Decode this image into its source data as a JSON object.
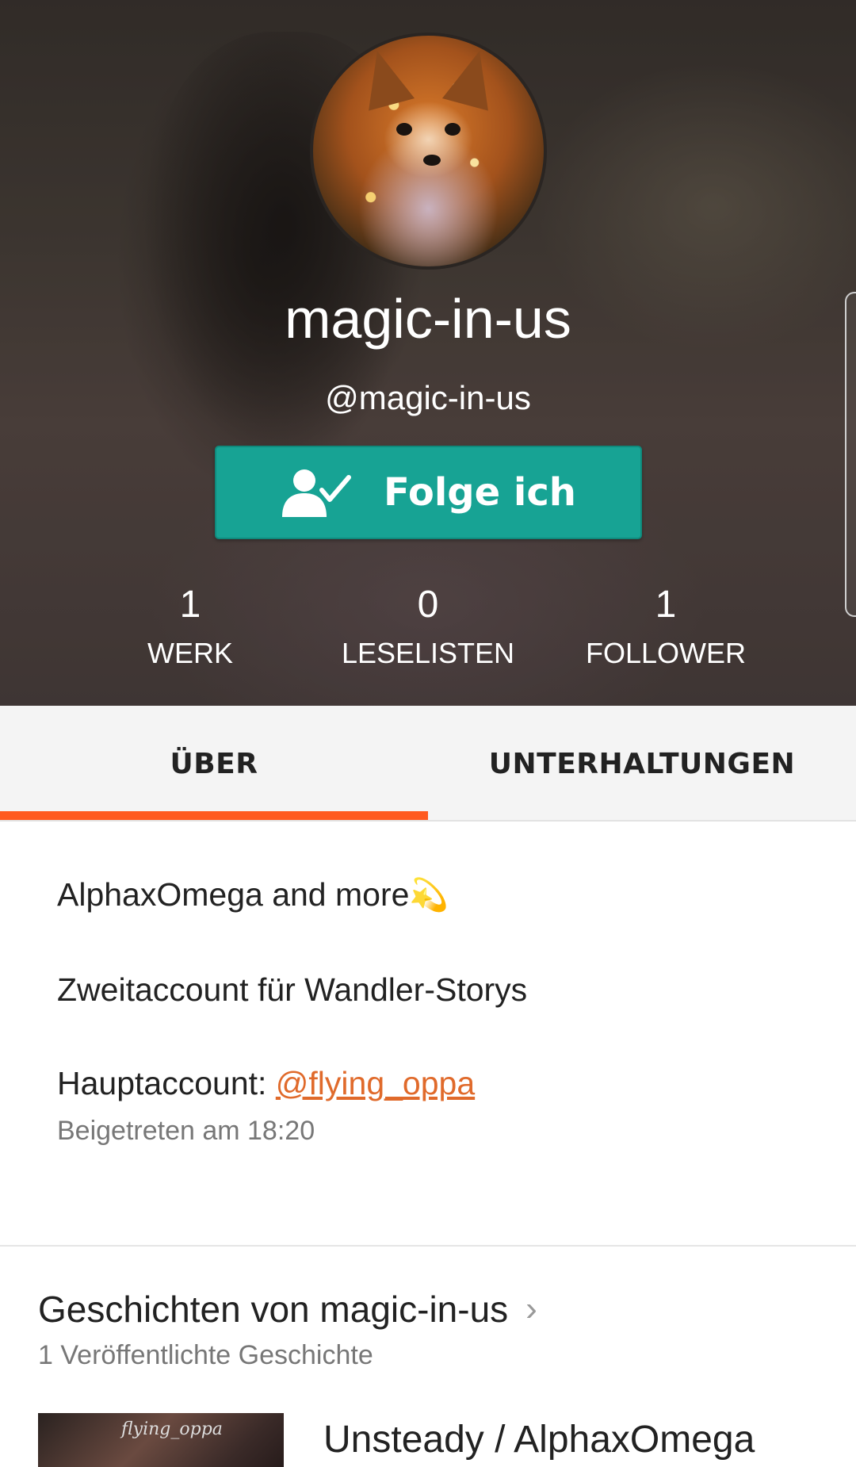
{
  "profile": {
    "display_name": "magic-in-us",
    "handle": "@magic-in-us",
    "follow_button_label": "Folge ich",
    "stats": [
      {
        "value": "1",
        "label": "WERK"
      },
      {
        "value": "0",
        "label": "LESELISTEN"
      },
      {
        "value": "1",
        "label": "FOLLOWER"
      }
    ]
  },
  "tabs": [
    {
      "label": "ÜBER",
      "active": true
    },
    {
      "label": "UNTERHALTUNGEN",
      "active": false
    }
  ],
  "about": {
    "line1": "AlphaxOmega and more",
    "line1_emoji": "💫",
    "line2": "Zweitaccount für Wandler-Storys",
    "line3_prefix": "Hauptaccount: ",
    "line3_link": "@flying_oppa",
    "joined": "Beigetreten am 18:20"
  },
  "stories": {
    "title": "Geschichten von magic-in-us",
    "subtitle": "1 Veröffentlichte Geschichte",
    "items": [
      {
        "title": "Unsteady / AlphaxOmega",
        "cover_watermark": "flying_oppa"
      }
    ]
  },
  "colors": {
    "accent_teal": "#17a394",
    "tab_indicator": "#ff5a1f",
    "link": "#e06a2b"
  },
  "icons": {
    "follow": "person-check-icon",
    "stories_chevron": "chevron-right-icon"
  }
}
